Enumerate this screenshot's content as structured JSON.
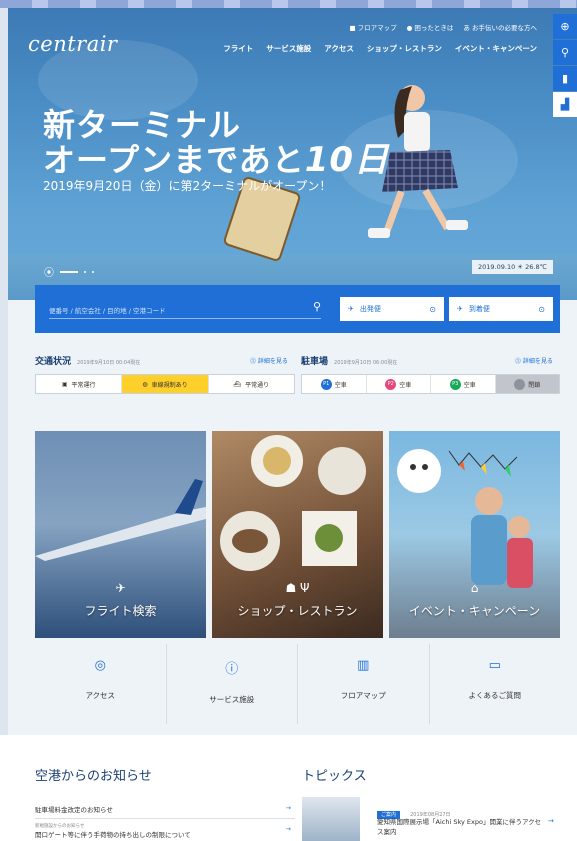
{
  "brand": {
    "logo": "centrair"
  },
  "util_nav": [
    "■ フロアマップ",
    "● 困ったときは",
    "あ お手伝いの必要な方へ"
  ],
  "main_nav": [
    "フライト",
    "サービス施設",
    "アクセス",
    "ショップ・レストラン",
    "イベント・キャンペーン"
  ],
  "hero": {
    "title_line1": "新ターミナル",
    "title_line2": "オープンまであと",
    "days": "10日",
    "subtitle": "2019年9月20日（金）に第2ターミナルがオープン！",
    "weather": "2019.09.10 ☀ 26.8℃"
  },
  "search": {
    "placeholder": "便番号 / 航空会社 / 目的地 / 空港コード",
    "departures": "出発便",
    "arrivals": "到着便"
  },
  "traffic": {
    "title": "交通状況",
    "time": "2019年9月10日 00:04現在",
    "more": "⓵ 詳細を見る",
    "items": [
      "平常運行",
      "車線規制あり",
      "平常通り"
    ]
  },
  "parking": {
    "title": "駐車場",
    "time": "2019年9月10日 06:00現在",
    "more": "⓵ 詳細を見る",
    "items": [
      {
        "badge": "P1",
        "status": "空車"
      },
      {
        "badge": "P2",
        "status": "空車"
      },
      {
        "badge": "P3",
        "status": "空車"
      },
      {
        "badge": "",
        "status": "閉鎖"
      }
    ]
  },
  "cards": [
    "フライト検索",
    "ショップ・レストラン",
    "イベント・キャンペーン"
  ],
  "quick_links": [
    "アクセス",
    "サービス施設",
    "フロアマップ",
    "よくあるご質問"
  ],
  "notices": {
    "title": "空港からのお知らせ",
    "items": [
      {
        "text": "駐車場料金改定のお知らせ",
        "sub": ""
      },
      {
        "text": "開口ゲート等に伴う手荷物の持ち出しの制限について",
        "sub": "新規施設からのお知らせ"
      }
    ]
  },
  "topics": {
    "title": "トピックス",
    "badge": "ご案内",
    "date": "2019年08月27日",
    "text": "愛知県国際展示場「Aichi Sky Expo」開業に伴うアクセス案内"
  },
  "colors": {
    "primary": "#1f6fd6",
    "highlight": "#ffd02a",
    "heading": "#1a3f73"
  }
}
